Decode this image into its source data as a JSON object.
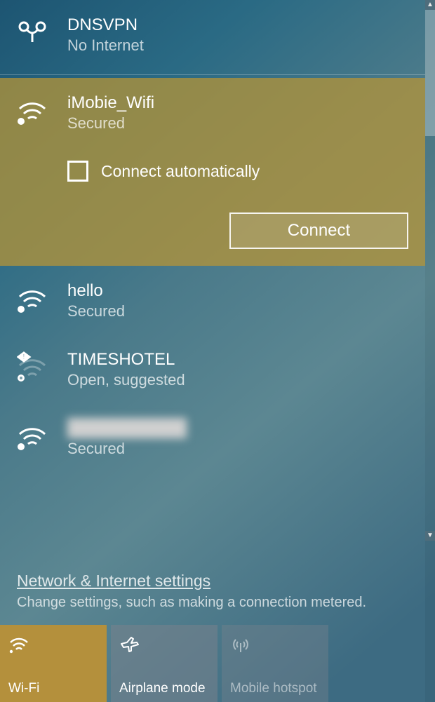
{
  "networks": [
    {
      "icon": "vpn-icon",
      "name": "DNSVPN",
      "status": "No Internet",
      "divider": true
    }
  ],
  "selected": {
    "icon": "wifi-icon",
    "name": "iMobie_Wifi",
    "status": "Secured",
    "auto_label": "Connect automatically",
    "auto_checked": false,
    "connect_label": "Connect"
  },
  "networks_after": [
    {
      "icon": "wifi-icon",
      "name": "hello",
      "status": "Secured"
    },
    {
      "icon": "wifi-open-icon",
      "name": "TIMESHOTEL",
      "status": "Open, suggested"
    },
    {
      "icon": "wifi-icon",
      "name": "██████████",
      "status": "Secured",
      "blurred": true
    }
  ],
  "settings": {
    "link": "Network & Internet settings",
    "sub": "Change settings, such as making a connection metered."
  },
  "tiles": [
    {
      "id": "wifi",
      "label": "Wi-Fi",
      "state": "active",
      "icon": "wifi-small-icon"
    },
    {
      "id": "airplane",
      "label": "Airplane mode",
      "state": "inactive",
      "icon": "airplane-icon"
    },
    {
      "id": "hotspot",
      "label": "Mobile hotspot",
      "state": "disabled",
      "icon": "hotspot-icon"
    }
  ]
}
